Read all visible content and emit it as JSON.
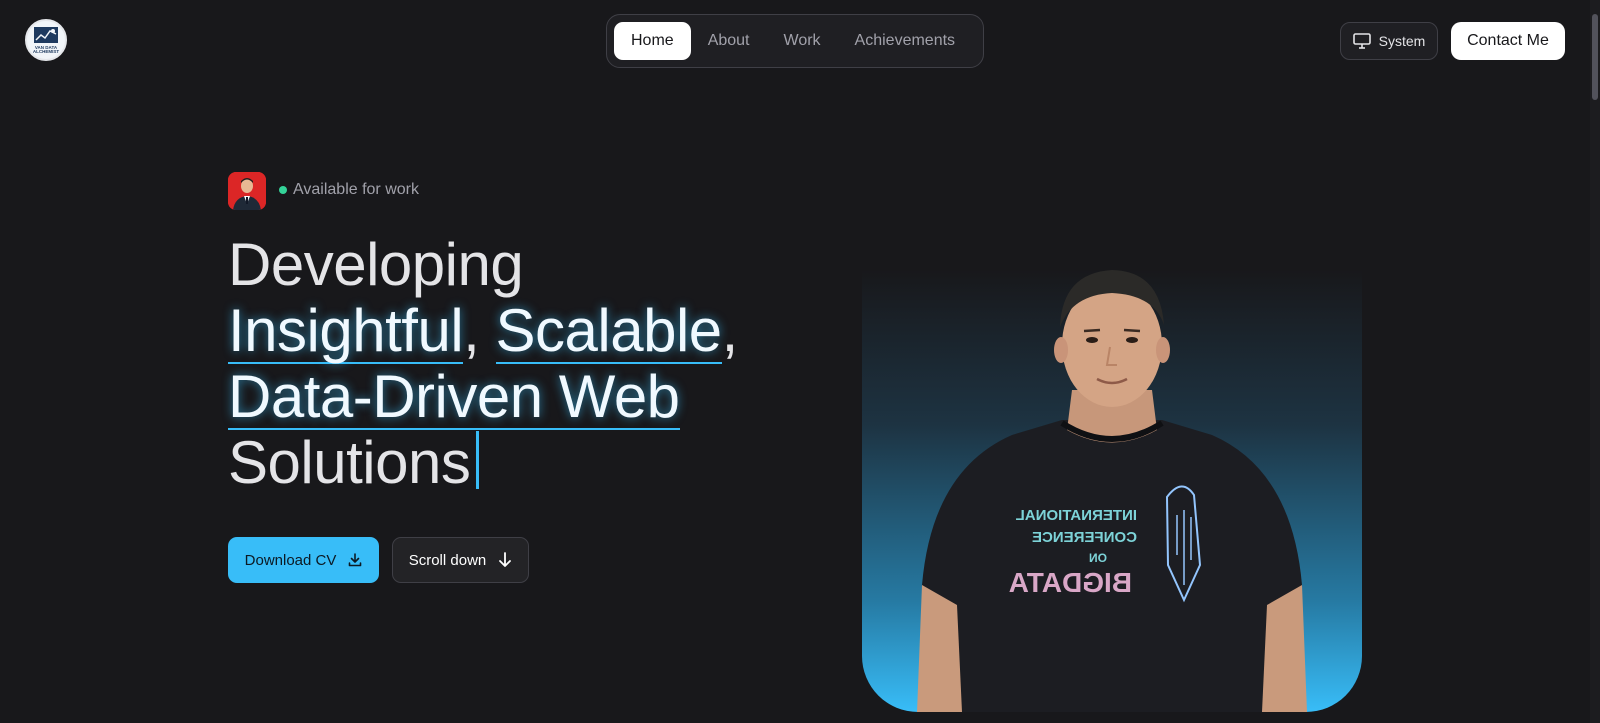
{
  "logo": {
    "text_line1": "VAN DATA",
    "text_line2": "ALCHEMIST"
  },
  "nav": {
    "items": [
      {
        "label": "Home",
        "active": true
      },
      {
        "label": "About",
        "active": false
      },
      {
        "label": "Work",
        "active": false
      },
      {
        "label": "Achievements",
        "active": false
      }
    ]
  },
  "header": {
    "system_label": "System",
    "system_icon": "monitor-icon",
    "contact_label": "Contact Me"
  },
  "hero": {
    "status_text": "Available for work",
    "headline": {
      "line1": "Developing",
      "word_insightful": "Insightful",
      "comma": ",",
      "word_scalable": "Scalable",
      "phrase_data_driven": "Data-Driven Web",
      "line4": "Solutions"
    },
    "download_label": "Download CV",
    "download_icon": "download-icon",
    "scroll_label": "Scroll down",
    "scroll_icon": "arrow-down-icon",
    "shirt_text_line1": "INTERNATIONAL",
    "shirt_text_line2": "CONFERENCE",
    "shirt_text_line3": "ON",
    "shirt_text_line4": "BIGDATA"
  },
  "colors": {
    "accent": "#38bdf8",
    "background": "#18181b",
    "status_dot": "#34d399"
  }
}
